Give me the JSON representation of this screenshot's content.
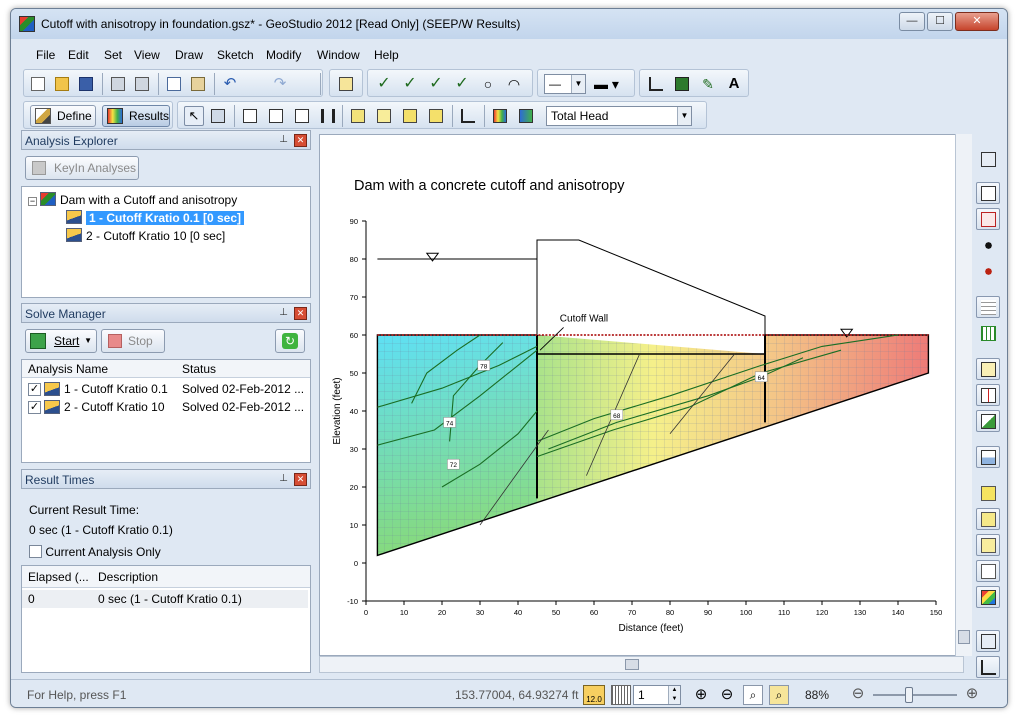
{
  "window": {
    "title": "Cutoff with anisotropy in foundation.gsz* - GeoStudio 2012 [Read Only] (SEEP/W Results)",
    "min_glyph": "—",
    "max_glyph": "☐",
    "close_glyph": "✕"
  },
  "menu": [
    "File",
    "Edit",
    "Set",
    "View",
    "Draw",
    "Sketch",
    "Modify",
    "Window",
    "Help"
  ],
  "toolbar": {
    "define_label": "Define",
    "results_label": "Results",
    "result_type": "Total Head"
  },
  "analysis_explorer": {
    "title": "Analysis Explorer",
    "keyin_label": "KeyIn Analyses",
    "root": "Dam with a Cutoff and anisotropy",
    "items": [
      "1 - Cutoff Kratio 0.1 [0 sec]",
      "2 - Cutoff Kratio 10 [0 sec]"
    ]
  },
  "solve_manager": {
    "title": "Solve Manager",
    "start_label": "Start",
    "stop_label": "Stop",
    "col_name": "Analysis Name",
    "col_status": "Status",
    "rows": [
      {
        "name": "1 - Cutoff Kratio 0.1",
        "status": "Solved 02-Feb-2012 ..."
      },
      {
        "name": "2 - Cutoff Kratio 10",
        "status": "Solved 02-Feb-2012 ..."
      }
    ]
  },
  "result_times": {
    "title": "Result Times",
    "current_label": "Current Result Time:",
    "current_value": "0 sec (1 - Cutoff Kratio 0.1)",
    "current_only_label": "Current Analysis Only",
    "col_elapsed": "Elapsed (...",
    "col_desc": "Description",
    "rows": [
      {
        "elapsed": "0",
        "desc": "0 sec (1 - Cutoff Kratio 0.1)"
      }
    ]
  },
  "chart_data": {
    "type": "contour-section",
    "title": "Dam with a concrete cutoff and anisotropy",
    "xlabel": "Distance (feet)",
    "ylabel": "Elevation (feet)",
    "xlim": [
      0,
      150
    ],
    "ylim": [
      -10,
      90
    ],
    "xticks": [
      0,
      10,
      20,
      30,
      40,
      50,
      60,
      70,
      80,
      90,
      100,
      110,
      120,
      130,
      140,
      150
    ],
    "yticks": [
      -10,
      0,
      10,
      20,
      30,
      40,
      50,
      60,
      70,
      80,
      90
    ],
    "annotation": "Cutoff Wall",
    "contour_labels": [
      "78",
      "74",
      "72",
      "68",
      "64"
    ],
    "grid": false
  },
  "status": {
    "help": "For Help, press F1",
    "coords": "153.77004, 64.93274 ft",
    "scale_value": "1",
    "zoom": "88%",
    "scale_badge": "12.0"
  }
}
